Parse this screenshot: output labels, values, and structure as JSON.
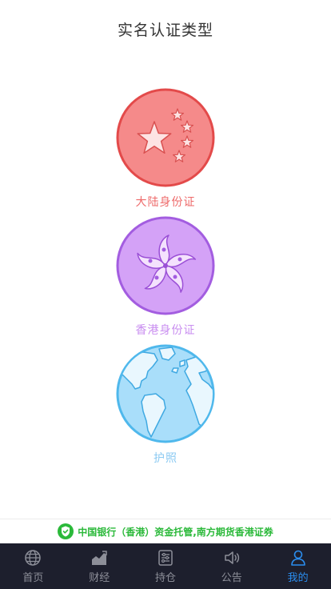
{
  "header": {
    "title": "实名认证类型"
  },
  "options": [
    {
      "label": "大陆身份证",
      "color": "#ee6a6a"
    },
    {
      "label": "香港身份证",
      "color": "#c98ef0"
    },
    {
      "label": "护照",
      "color": "#8ccaf2"
    }
  ],
  "banner": {
    "text": "中国银行（香港）资金托管,南方期货香港证券",
    "color": "#2bb93a"
  },
  "tabbar": {
    "tabs": [
      {
        "label": "首页",
        "icon": "globe-icon"
      },
      {
        "label": "财经",
        "icon": "chart-icon"
      },
      {
        "label": "持仓",
        "icon": "holdings-icon"
      },
      {
        "label": "公告",
        "icon": "speaker-icon"
      },
      {
        "label": "我的",
        "icon": "user-icon",
        "active": true
      }
    ],
    "active_color": "#2b8ef0"
  }
}
